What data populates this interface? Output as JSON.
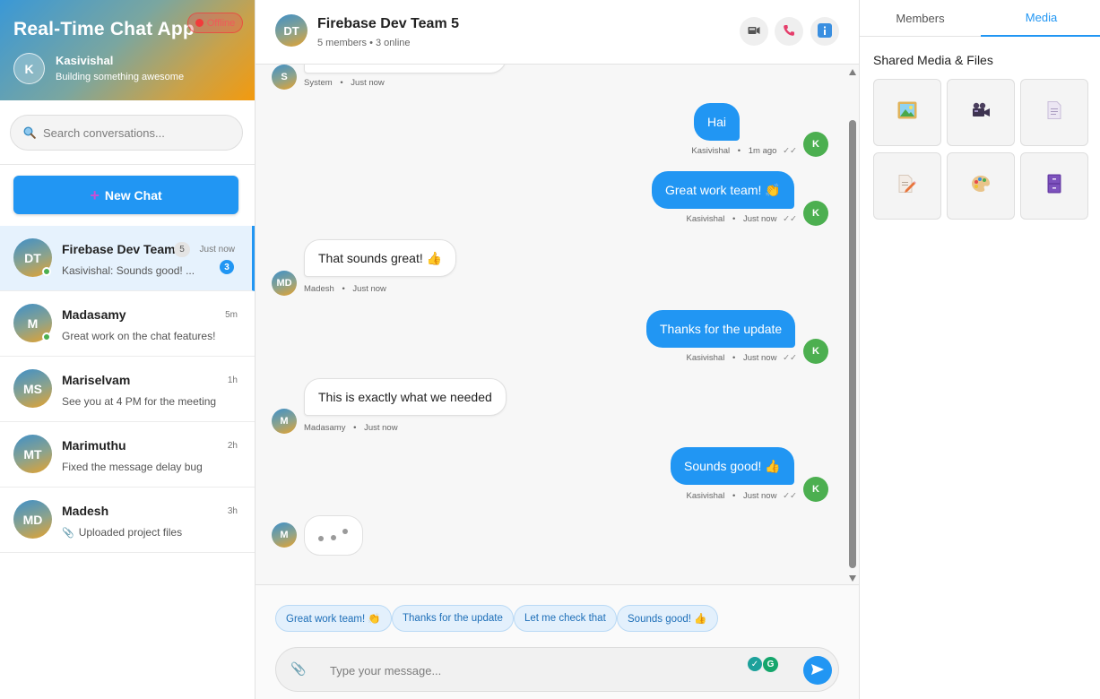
{
  "app": {
    "title": "Real-Time Chat App",
    "connection_status": "Offline",
    "user": {
      "initial": "K",
      "name": "Kasivishal",
      "status": "Building something awesome"
    }
  },
  "search": {
    "placeholder": "Search conversations..."
  },
  "new_chat": {
    "label": "New Chat"
  },
  "conversations": [
    {
      "initials": "DT",
      "name": "Firebase Dev Team",
      "member_count": "5",
      "time": "Just now",
      "preview": "Kasivishal: Sounds good! ...",
      "unread": "3",
      "online": true,
      "active": true
    },
    {
      "initials": "M",
      "name": "Madasamy",
      "time": "5m",
      "preview": "Great work on the chat features!",
      "online": true
    },
    {
      "initials": "MS",
      "name": "Mariselvam",
      "time": "1h",
      "preview": "See you at 4 PM for the meeting"
    },
    {
      "initials": "MT",
      "name": "Marimuthu",
      "time": "2h",
      "preview": "Fixed the message delay bug"
    },
    {
      "initials": "MD",
      "name": "Madesh",
      "time": "3h",
      "preview": "Uploaded project files"
    }
  ],
  "chat": {
    "initials": "DT",
    "title": "Firebase Dev Team 5",
    "subtitle": "5 members • 3 online",
    "header_buttons": [
      "video-icon",
      "phone-icon",
      "info-icon"
    ]
  },
  "messages": [
    {
      "direction": "in",
      "sender_initial": "S",
      "sender": "System",
      "time": "Just now",
      "text": ""
    },
    {
      "direction": "out",
      "sender_initial": "K",
      "sender": "Kasivishal",
      "time": "1m ago",
      "text": "Hai"
    },
    {
      "direction": "out",
      "sender_initial": "K",
      "sender": "Kasivishal",
      "time": "Just now",
      "text": "Great work team! 👏"
    },
    {
      "direction": "in",
      "sender_initial": "MD",
      "sender": "Madesh",
      "time": "Just now",
      "text": "That sounds great! 👍"
    },
    {
      "direction": "out",
      "sender_initial": "K",
      "sender": "Kasivishal",
      "time": "Just now",
      "text": "Thanks for the update"
    },
    {
      "direction": "in",
      "sender_initial": "M",
      "sender": "Madasamy",
      "time": "Just now",
      "text": "This is exactly what we needed"
    },
    {
      "direction": "out",
      "sender_initial": "K",
      "sender": "Kasivishal",
      "time": "Just now",
      "text": "Sounds good! 👍"
    }
  ],
  "typing": {
    "sender_initial": "M"
  },
  "meta": {
    "separator": "•",
    "read_ticks": "✓✓"
  },
  "quick_replies": [
    "Great work team! 👏",
    "Thanks for the update",
    "Let me check that",
    "Sounds good! 👍"
  ],
  "composer": {
    "placeholder": "Type your message..."
  },
  "right_panel": {
    "tabs": [
      "Members",
      "Media"
    ],
    "active_tab": "Media",
    "media_title": "Shared Media & Files",
    "media_items": [
      "image-icon",
      "video-camera-icon",
      "document-icon",
      "edit-document-icon",
      "palette-icon",
      "archive-icon"
    ]
  },
  "colors": {
    "accent": "#2196f3",
    "online": "#4caf50",
    "offline": "#f23b3b"
  }
}
